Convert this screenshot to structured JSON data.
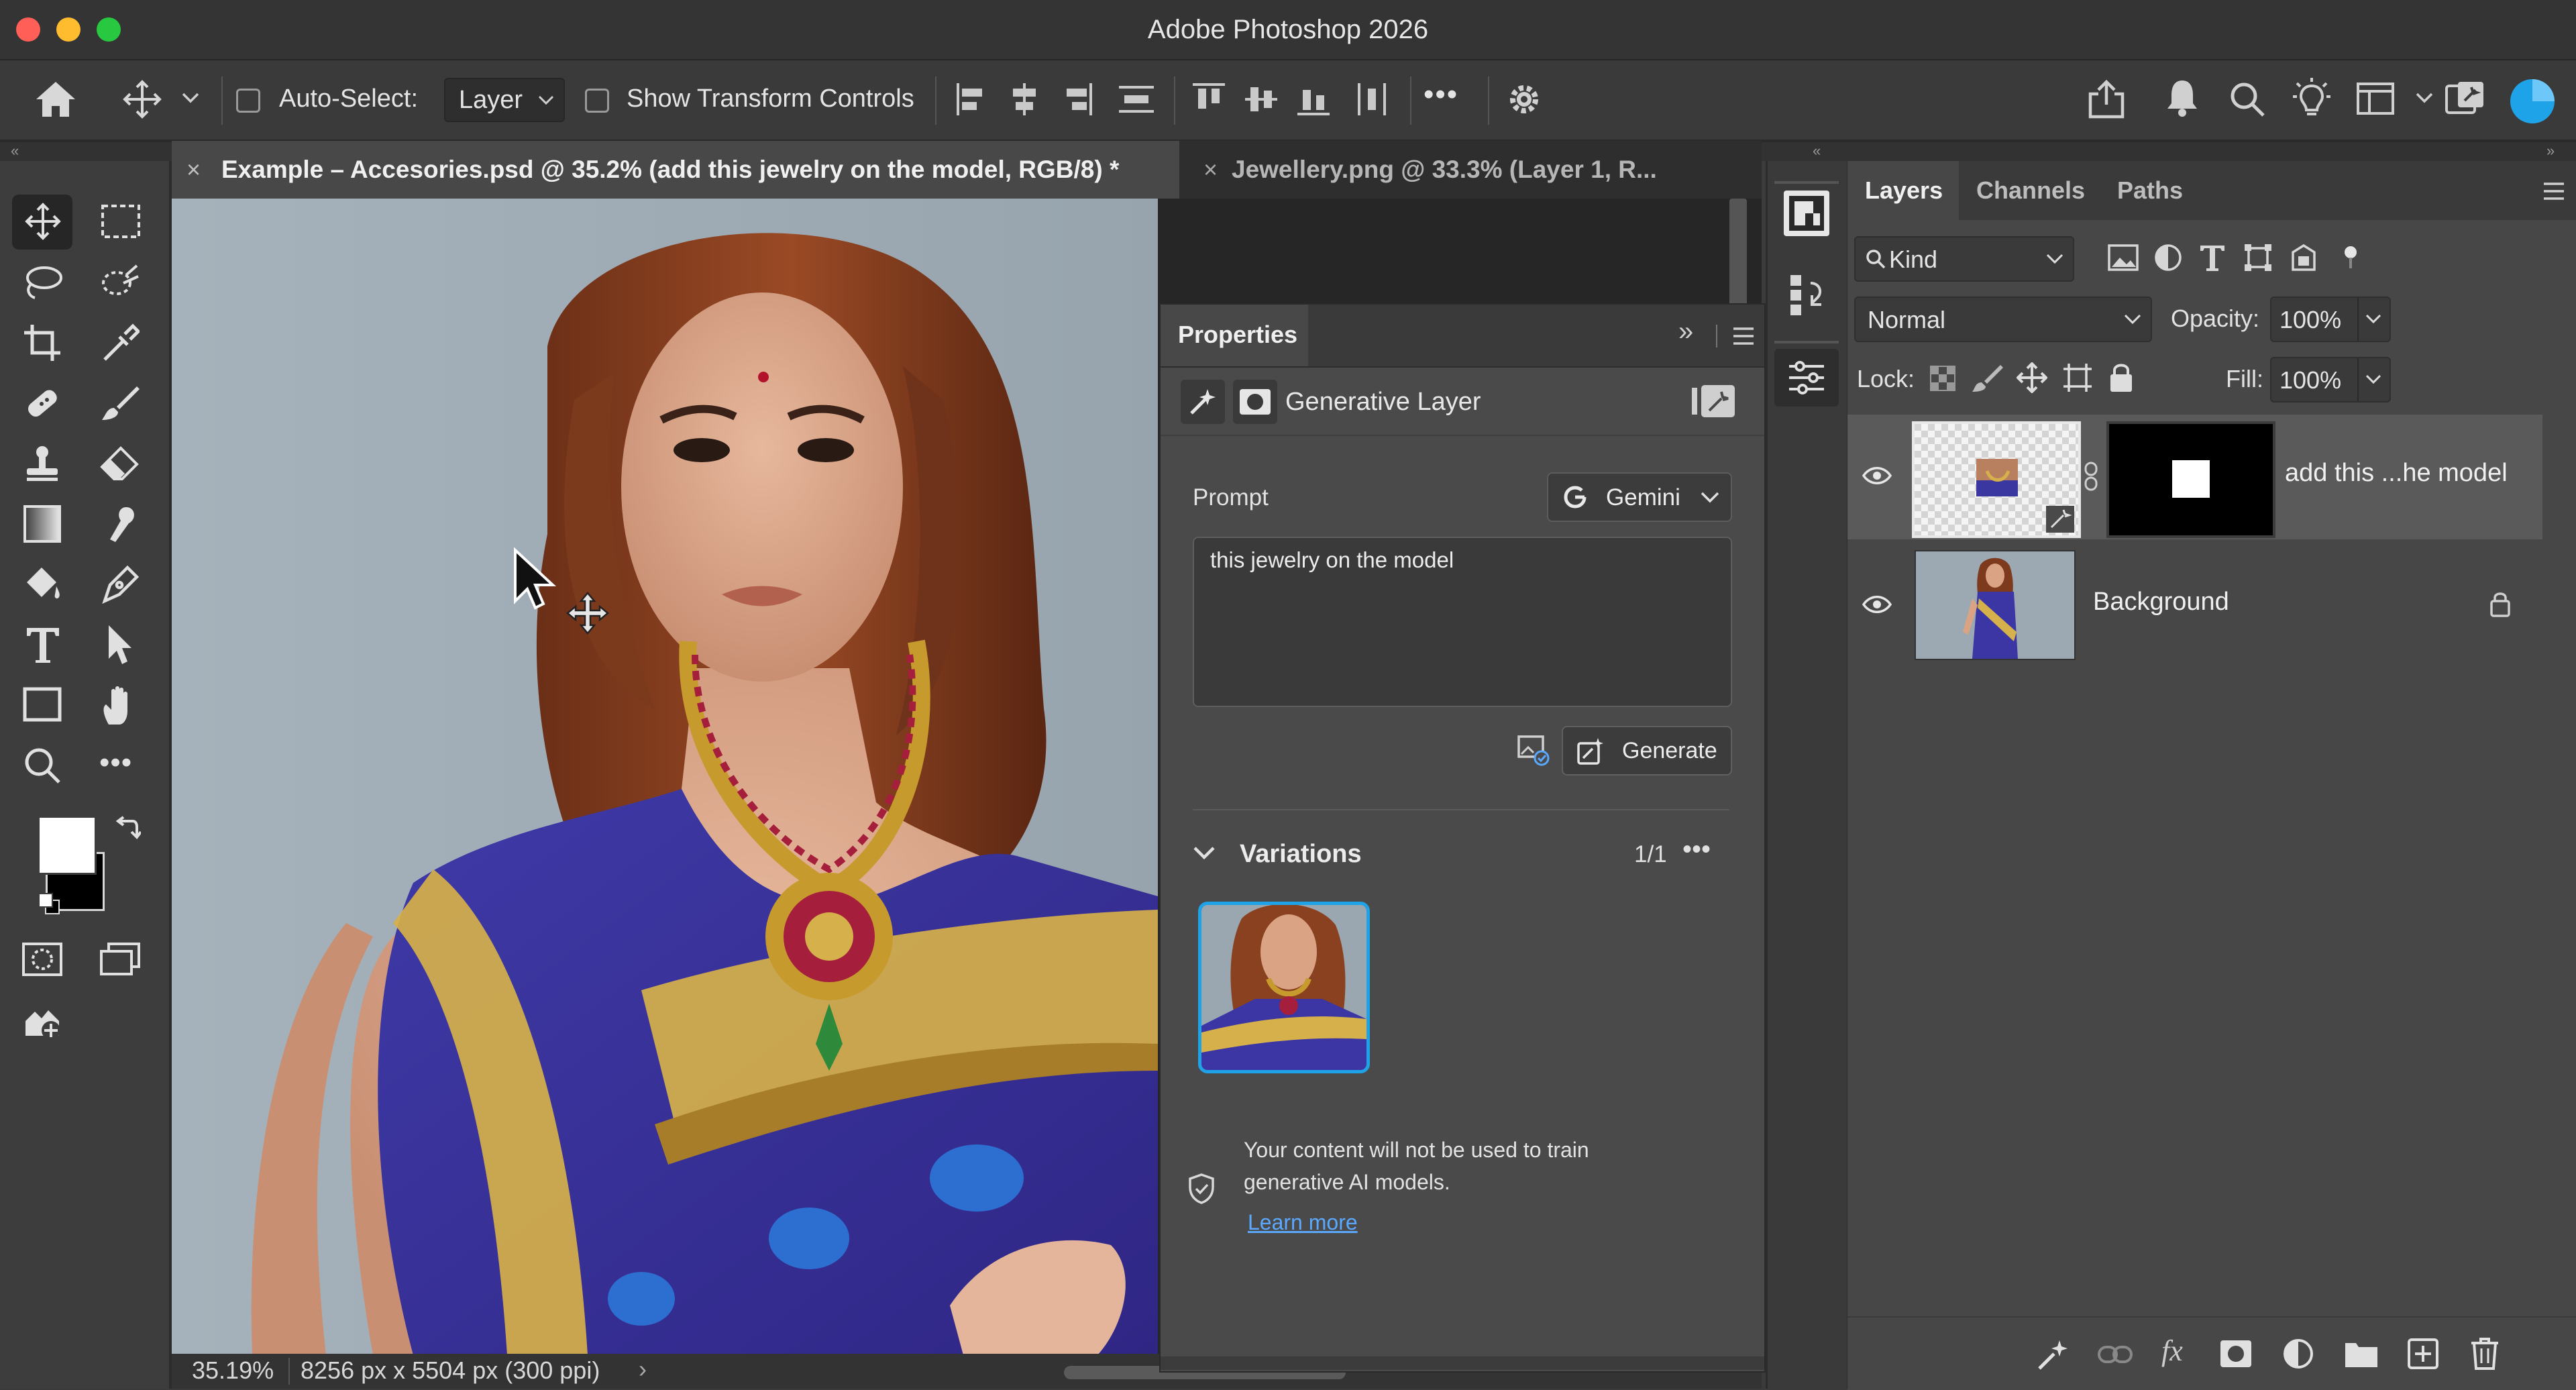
{
  "window": {
    "title": "Adobe Photoshop 2026"
  },
  "options_bar": {
    "auto_select_label": "Auto-Select:",
    "auto_select_value": "Layer",
    "show_transform_label": "Show Transform Controls",
    "more_label": "•••"
  },
  "tabs": [
    {
      "label": "Example – Accesories.psd @ 35.2% (add this jewelry on the model, RGB/8) *",
      "active": true
    },
    {
      "label": "Jewellery.png @ 33.3% (Layer 1, R...",
      "active": false
    }
  ],
  "status_bar": {
    "zoom": "35.19%",
    "doc_size": "8256 px x 5504 px (300 ppi)"
  },
  "properties": {
    "title": "Properties",
    "layer_type": "Generative Layer",
    "prompt_label": "Prompt",
    "model": "Gemini",
    "prompt_text": "this jewelry on the model",
    "generate_label": "Generate",
    "variations_label": "Variations",
    "variations_count": "1/1",
    "notice_line1": "Your content will not be used to train",
    "notice_line2": "generative AI models.",
    "learn_more": "Learn more"
  },
  "layers_panel": {
    "tabs": [
      "Layers",
      "Channels",
      "Paths"
    ],
    "filter_kind": "Kind",
    "blend_mode": "Normal",
    "opacity_label": "Opacity:",
    "opacity_value": "100%",
    "lock_label": "Lock:",
    "fill_label": "Fill:",
    "fill_value": "100%",
    "layers": [
      {
        "name": "add this ...he model",
        "selected": true,
        "visible": true,
        "locked": false
      },
      {
        "name": "Background",
        "selected": false,
        "visible": true,
        "locked": true
      }
    ]
  },
  "colors": {
    "accent_blue": "#1fa3e8",
    "link_blue": "#5aa9ff",
    "saree_purple": "#3c2f9a",
    "gold": "#d6b04a"
  }
}
